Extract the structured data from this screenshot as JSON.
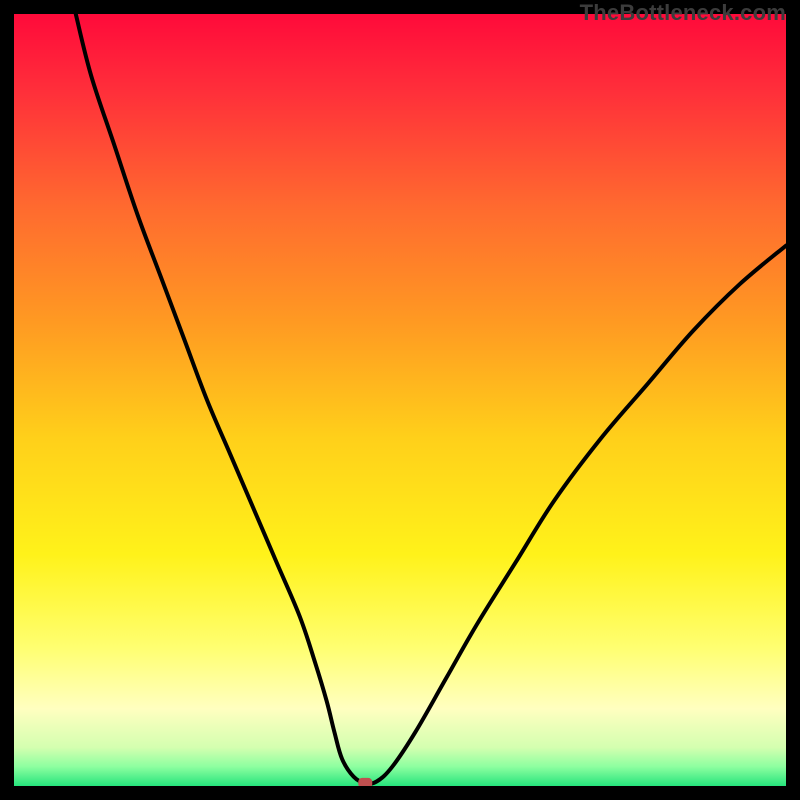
{
  "watermark": "TheBottleneck.com",
  "chart_data": {
    "type": "line",
    "title": "",
    "xlabel": "",
    "ylabel": "",
    "xlim": [
      0,
      100
    ],
    "ylim": [
      0,
      100
    ],
    "gradient_stops": [
      {
        "offset": 0.0,
        "color": "#ff0a3a"
      },
      {
        "offset": 0.1,
        "color": "#ff2f3a"
      },
      {
        "offset": 0.25,
        "color": "#ff6a2f"
      },
      {
        "offset": 0.4,
        "color": "#ff9a22"
      },
      {
        "offset": 0.55,
        "color": "#ffd01a"
      },
      {
        "offset": 0.7,
        "color": "#fff21a"
      },
      {
        "offset": 0.82,
        "color": "#ffff70"
      },
      {
        "offset": 0.9,
        "color": "#ffffc0"
      },
      {
        "offset": 0.95,
        "color": "#d4ffb0"
      },
      {
        "offset": 0.975,
        "color": "#8dffa0"
      },
      {
        "offset": 1.0,
        "color": "#26e47c"
      }
    ],
    "series": [
      {
        "name": "bottleneck-curve",
        "x": [
          8,
          10,
          13,
          16,
          19,
          22,
          25,
          28,
          31,
          34,
          37,
          39,
          40.5,
          41.5,
          42.5,
          44,
          45.5,
          47,
          49,
          52,
          56,
          60,
          65,
          70,
          76,
          82,
          88,
          94,
          100
        ],
        "y": [
          100,
          92,
          83,
          74,
          66,
          58,
          50,
          43,
          36,
          29,
          22,
          16,
          11,
          7,
          3.5,
          1.2,
          0.4,
          0.6,
          2.5,
          7,
          14,
          21,
          29,
          37,
          45,
          52,
          59,
          65,
          70
        ]
      }
    ],
    "marker": {
      "x": 45.5,
      "y": 0.4,
      "color": "#c05050"
    }
  }
}
